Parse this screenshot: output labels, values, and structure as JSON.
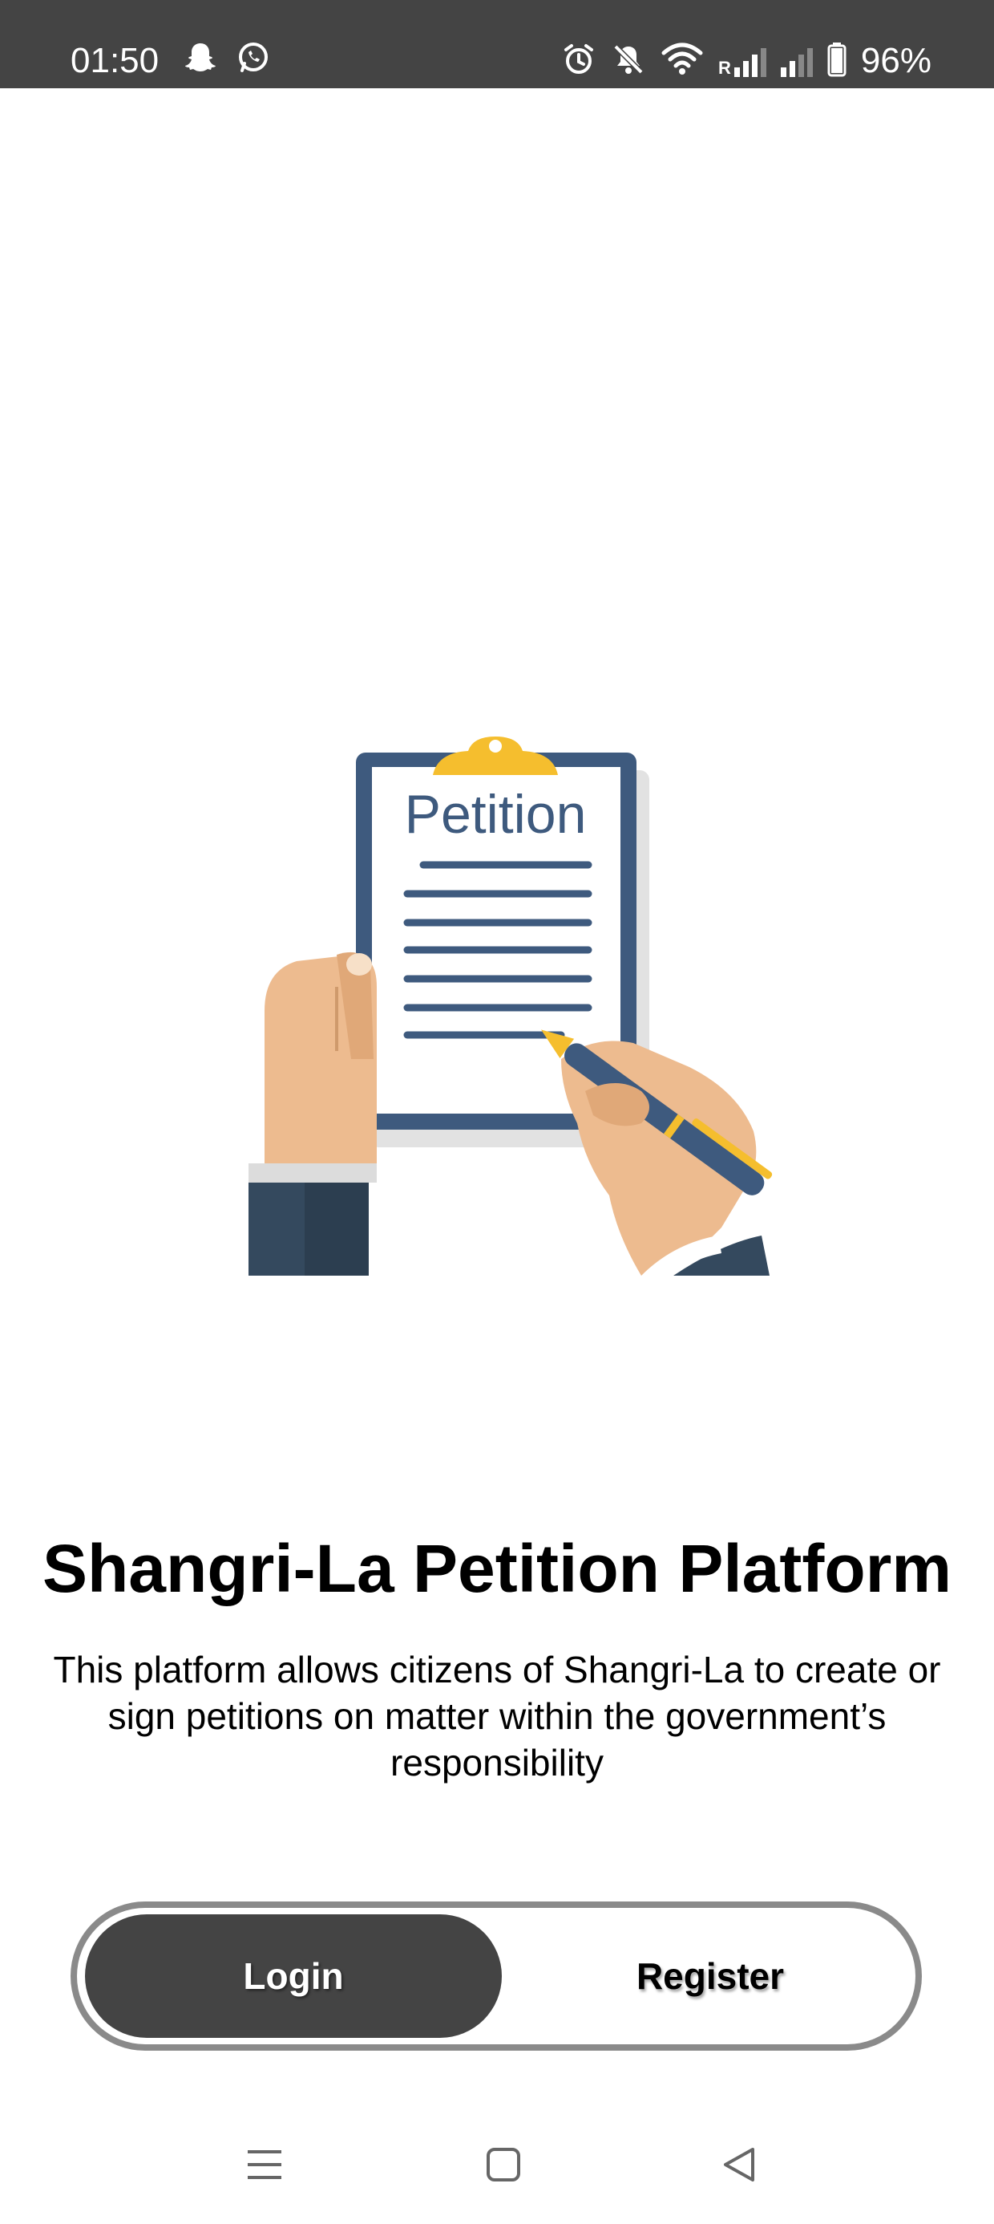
{
  "status_bar": {
    "time": "01:50",
    "battery_percent": "96%",
    "signal_roaming_label": "R",
    "icons": [
      "snapchat-icon",
      "whatsapp-icon",
      "alarm-icon",
      "mute-icon",
      "wifi-icon",
      "signal-roaming-icon",
      "signal-icon",
      "battery-icon"
    ]
  },
  "illustration": {
    "clipboard_label": "Petition",
    "colors": {
      "board": "#3e5a7e",
      "clip": "#f5be2e",
      "skin": "#edbb8f",
      "sleeve": "#34495e",
      "paper": "#ffffff",
      "shadow": "#e2e2e2"
    }
  },
  "main": {
    "title": "Shangri-La Petition Platform",
    "description": "This platform allows citizens of Shangri-La to create or sign petitions on matter within the government’s responsibility"
  },
  "auth_toggle": {
    "login_label": "Login",
    "register_label": "Register",
    "selected": "Login",
    "active_color": "#444444",
    "border_color": "#8a8a8a"
  },
  "nav_bar": {
    "icons": [
      "recent-apps-icon",
      "home-icon",
      "back-icon"
    ]
  }
}
